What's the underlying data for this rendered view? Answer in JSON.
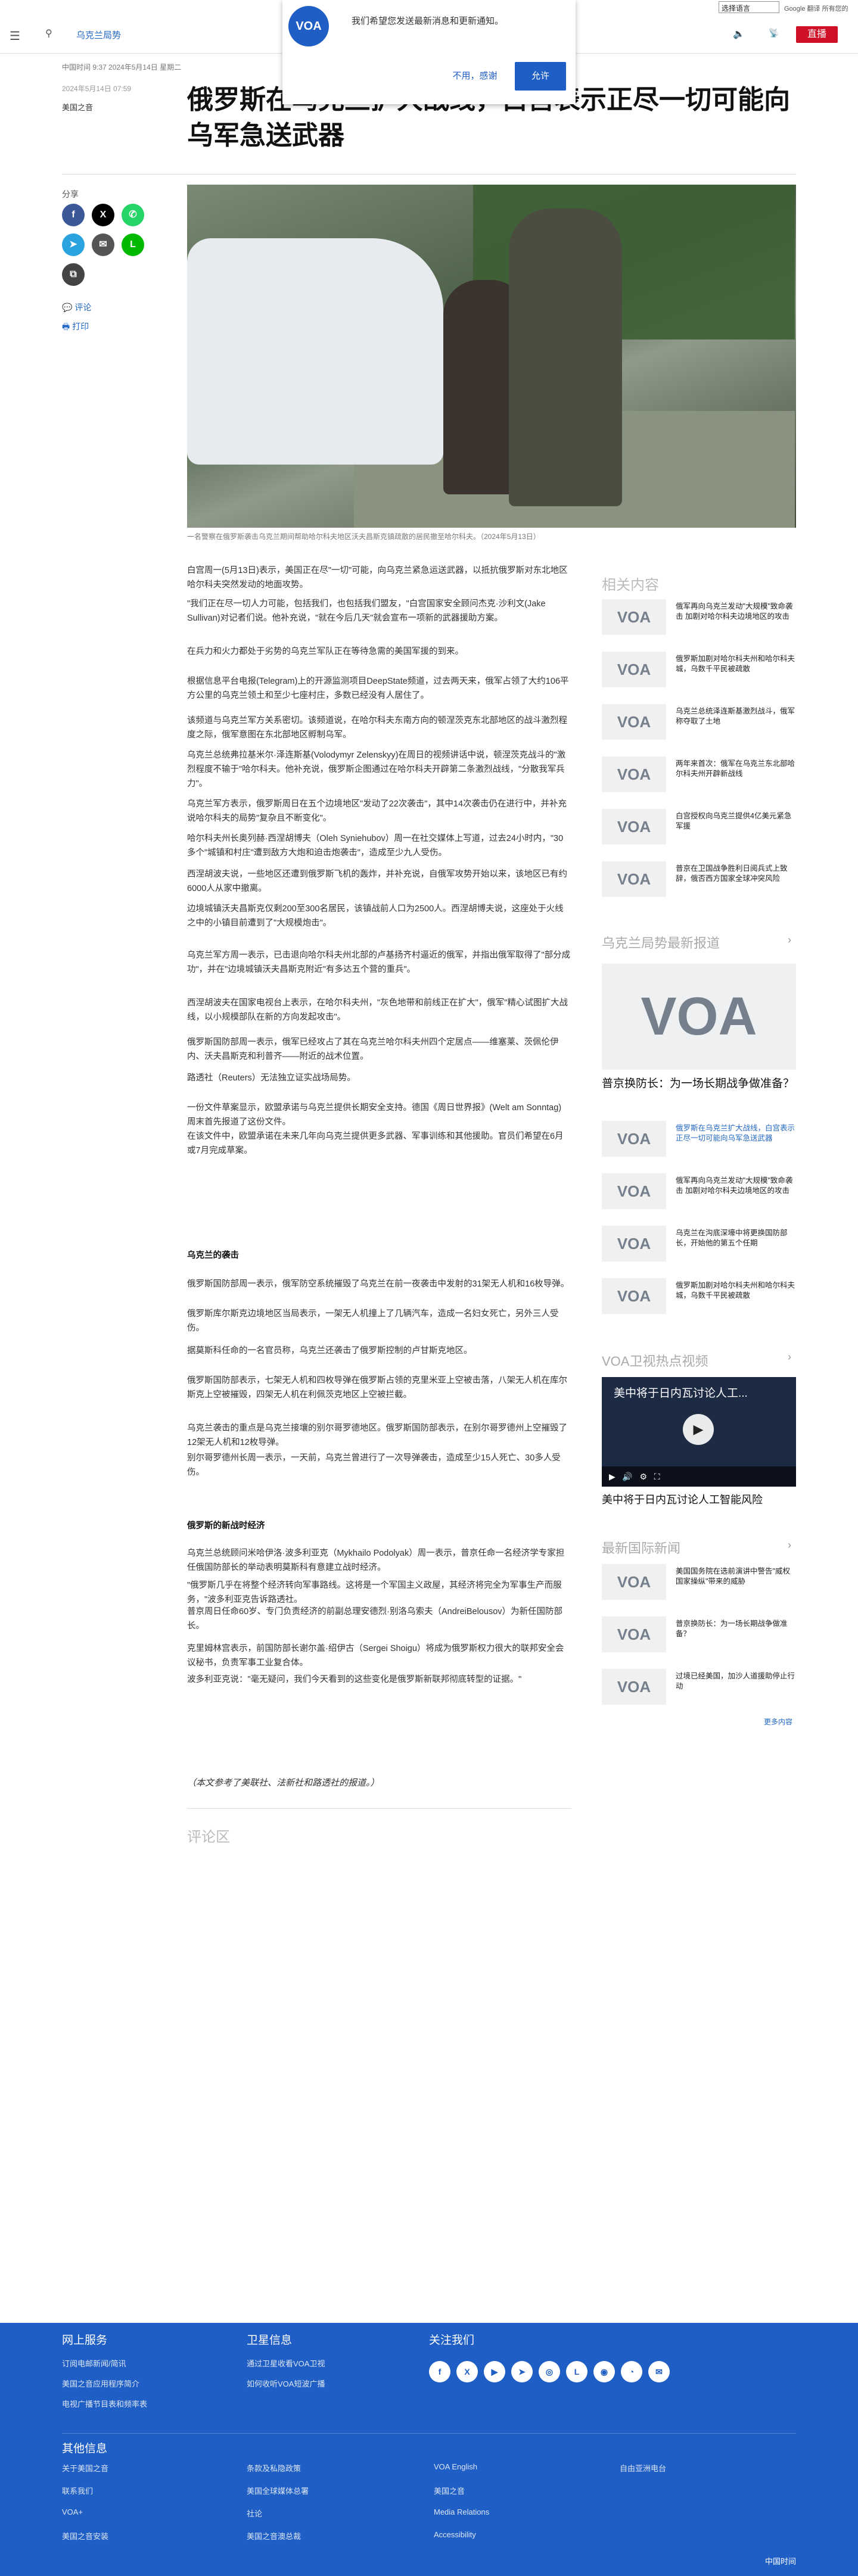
{
  "topbar": {
    "language_select": "选择语言",
    "google_translate": "Google 翻译 所有您的",
    "section": "乌克兰局势",
    "live_label": "直播"
  },
  "popup": {
    "logo": "VOA",
    "logo_sub": "美国之音",
    "message": "我们希望您发送最新消息和更新通知。",
    "decline": "不用，感谢",
    "accept": "允许"
  },
  "article": {
    "meta_line": "中国时间 9:37 2024年5月14日 星期二",
    "date": "2024年5月14日 07:59",
    "category": "美国之音",
    "title": "俄罗斯在乌克兰扩大战线，白宫表示正尽一切可能向乌军急送武器",
    "share_label": "分享",
    "comment_link": "评论",
    "print_link": "打印",
    "caption": "一名警察在俄罗斯袭击乌克兰期间帮助哈尔科夫地区沃夫昌斯克镇疏散的居民撤至哈尔科夫。（2024年5月13日）",
    "paragraphs": [
      "白宫周一(5月13日)表示，美国正在尽\"一切\"可能，向乌克兰紧急运送武器，以抵抗俄罗斯对东北地区哈尔科夫突然发动的地面攻势。",
      "\"我们正在尽一切人力可能，包括我们，也包括我们盟友，\"白宫国家安全顾问杰克·沙利文(Jake Sullivan)对记者们说。他补充说，\"就在今后几天\"就会宣布一项新的武器援助方案。",
      "在兵力和火力都处于劣势的乌克兰军队正在等待急需的美国军援的到来。",
      "根据信息平台电报(Telegram)上的开源监测项目DeepState频道，过去两天来，俄军占领了大约106平方公里的乌克兰领土和至少七座村庄，多数已经没有人居住了。",
      "该频道与乌克兰军方关系密切。该频道说，在哈尔科夫东南方向的顿涅茨克东北部地区的战斗激烈程度之际，俄军意图在东北部地区孵制乌军。",
      "乌克兰总统弗拉基米尔·泽连斯基(Volodymyr Zelenskyy)在周日的视频讲话中说，顿涅茨克战斗的\"激烈程度不输于\"哈尔科夫。他补充说，俄罗斯企图通过在哈尔科夫开辟第二条激烈战线，\"分散我军兵力\"。",
      "乌克兰军方表示，俄罗斯周日在五个边境地区\"发动了22次袭击\"，其中14次袭击仍在进行中，并补充说哈尔科夫的局势\"复杂且不断变化\"。",
      "哈尔科夫州长奥列赫·西涅胡博夫（Oleh Syniehubov）周一在社交媒体上写道，过去24小时内，\"30多个\"城镇和村庄\"遭到敌方大炮和迫击炮袭击\"，造成至少九人受伤。",
      "西涅胡波夫说，一些地区还遭到俄罗斯飞机的轰炸，并补充说，自俄军攻势开始以来，该地区已有约6000人从家中撤离。",
      "边境城镇沃夫昌斯克仅剩200至300名居民，该镇战前人口为2500人。西涅胡博夫说，这座处于火线之中的小镇目前遭到了\"大规模炮击\"。",
      "乌克兰军方周一表示，已击退向哈尔科夫州北部的卢基扬齐村逼近的俄军，并指出俄军取得了\"部分成功\"，并在\"边境城镇沃夫昌斯克附近\"有多达五个营的重兵\"。",
      "西涅胡波夫在国家电视台上表示，在哈尔科夫州，\"灰色地带和前线正在扩大\"，俄军\"精心试图扩大战线，以小规模部队在新的方向发起攻击\"。",
      "俄罗斯国防部周一表示，俄军已经攻占了其在乌克兰哈尔科夫州四个定居点——维塞莱、茨佩伦伊内、沃夫昌斯克和利普齐——附近的战术位置。",
      "路透社（Reuters）无法独立证实战场局势。",
      "一份文件草案显示，欧盟承诺与乌克兰提供长期安全支持。德国《周日世界报》(Welt am Sonntag) 周末首先报道了这份文件。",
      "在该文件中，欧盟承诺在未来几年向乌克兰提供更多武器、军事训练和其他援助。官员们希望在6月或7月完成草案。",
      "乌克兰的袭击",
      "俄罗斯国防部周一表示，俄军防空系统摧毁了乌克兰在前一夜袭击中发射的31架无人机和16枚导弹。",
      "俄罗斯库尔斯克边境地区当局表示，一架无人机撞上了几辆汽车，造成一名妇女死亡，另外三人受伤。",
      "据莫斯科任命的一名官员称，乌克兰还袭击了俄罗斯控制的卢甘斯克地区。",
      "俄罗斯国防部表示，七架无人机和四枚导弹在俄罗斯占领的克里米亚上空被击落，八架无人机在库尔斯克上空被摧毁，四架无人机在利佩茨克地区上空被拦截。",
      "乌克兰袭击的重点是乌克兰接壤的别尔哥罗德地区。俄罗斯国防部表示，在别尔哥罗德州上空摧毁了12架无人机和12枚导弹。",
      "别尔哥罗德州长周一表示，一天前，乌克兰曾进行了一次导弹袭击，造成至少15人死亡、30多人受伤。",
      "俄罗斯的新战时经济",
      "乌克兰总统顾问米哈伊洛·波多利亚克（Mykhailo Podolyak）周一表示，普京任命一名经济学专家担任俄国防部长的举动表明莫斯科有意建立战时经济。",
      "\"俄罗斯几乎在将整个经济转向军事路线。这将是一个军国主义政屋，其经济将完全为军事生产而服务，\"波多利亚克告诉路透社。",
      "普京周日任命60岁、专门负责经济的前副总理安德烈·别洛乌索夫（AndreiBelousov）为新任国防部长。",
      "克里姆林宫表示，前国防部长谢尔盖·绍伊古（Sergei Shoigu）将成为俄罗斯权力很大的联邦安全会议秘书，负责军事工业复合体。",
      "波多利亚克说：\"毫无疑问，我们今天看到的这些变化是俄罗斯新联邦彻底转型的证据。\""
    ],
    "source_note": "（本文参考了美联社、法新社和路透社的报道。）",
    "comments_heading": "评论区"
  },
  "sidebar": {
    "related_heading": "相关内容",
    "related": [
      "俄军再向乌克兰发动\"大规模\"致命袭击 加剧对哈尔科夫边境地区的攻击",
      "俄罗斯加剧对哈尔科夫州和哈尔科夫城，乌数千平民被疏散",
      "乌克兰总统泽连斯基激烈战斗，俄军称夺取了土地",
      "两年来首次：俄军在乌克兰东北部哈尔科夫州开辟新战线",
      "白宫授权向乌克兰提供4亿美元紧急军援",
      "普京在卫国战争胜利日阅兵式上致辞，俄否西方国家全球冲突风险"
    ],
    "ukraine_heading": "乌克兰局势最新报道",
    "feature_logo": "VOA",
    "feature_title": "普京换防长：为一场长期战争做准备？",
    "ukraine": [
      "俄罗斯在乌克兰扩大战线，白宫表示正尽一切可能向乌军急送武器",
      "俄军再向乌克兰发动\"大规模\"致命袭击 加剧对哈尔科夫边境地区的攻击",
      "乌克兰在沟底深壕中将更换国防部长，开始他的第五个任期",
      "俄罗斯加剧对哈尔科夫州和哈尔科夫城，乌数千平民被疏散"
    ],
    "video_heading": "VOA卫视热点视频",
    "video_title": "美中将于日内瓦讨论人工...",
    "video_caption": "美中将于日内瓦讨论人工智能风险",
    "intl_heading": "最新国际新闻",
    "intl": [
      "美国国务院在选前演讲中警告\"威权国家操纵\"带来的威胁",
      "普京换防长：为一场长期战争做准备？",
      "过境已经美国，加沙人道援助停止行动"
    ],
    "more_link": "更多内容",
    "thumb_logo": "VOA"
  },
  "footer": {
    "online_heading": "网上服务",
    "online": [
      "订阅电邮新闻/简讯",
      "美国之音应用程序简介",
      "电视广播节目表和频率表"
    ],
    "satellite_heading": "卫星信息",
    "satellite": [
      "通过卫星收看VOA卫视",
      "如何收听VOA短波广播"
    ],
    "follow_heading": "关注我们",
    "other_heading": "其他信息",
    "col1": [
      "关于美国之音",
      "联系我们",
      "VOA+",
      "美国之音安装"
    ],
    "col2": [
      "条款及私隐政策",
      "美国全球媒体总署",
      "社论",
      "美国之音澳总裁"
    ],
    "col3": [
      "VOA English",
      "美国之音",
      "Media Relations",
      "Accessibility"
    ],
    "col4": [
      "自由亚洲电台"
    ],
    "copyright": "中国时间"
  },
  "colors": {
    "brand": "#1f5ec4",
    "live": "#ce1126"
  }
}
